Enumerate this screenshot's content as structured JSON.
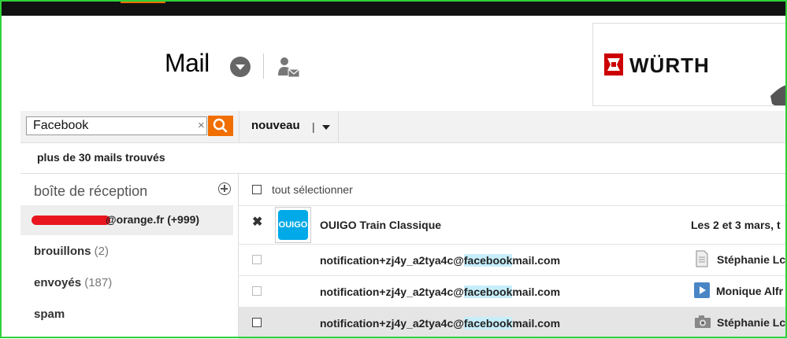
{
  "header": {
    "app_title": "Mail",
    "brand_color": "#f16e00",
    "dropdown_icon": "chevron-down-circle-icon",
    "contacts_icon": "contacts-icon"
  },
  "ad": {
    "brand": "WÜRTH",
    "brand_color": "#cc0000"
  },
  "search": {
    "value": "Facebook",
    "clear_label": "×"
  },
  "toolbar": {
    "new_label": "nouveau",
    "new_separator": "|"
  },
  "results": {
    "count_label": "plus de 30 mails trouvés"
  },
  "sidebar": {
    "header": "boîte de réception",
    "account": {
      "label": "@orange.fr (+999)"
    },
    "items": [
      {
        "label": "brouillons",
        "count": "(2)"
      },
      {
        "label": "envoyés",
        "count": "(187)"
      },
      {
        "label": "spam",
        "count": ""
      }
    ]
  },
  "mail_list": {
    "select_all_label": "tout sélectionner",
    "messages": [
      {
        "sender": "OUIGO Train Classique",
        "subject": "Les 2 et 3 mars, t",
        "avatar_text": "OUIGO"
      },
      {
        "sender_before": "notification+zj4y_a2tya4c@",
        "sender_match": "facebook",
        "sender_after": "mail.com",
        "recipient": "Stéphanie Lc",
        "attachment_icon": "document-icon"
      },
      {
        "sender_before": "notification+zj4y_a2tya4c@",
        "sender_match": "facebook",
        "sender_after": "mail.com",
        "recipient": "Monique Alfr",
        "attachment_icon": "video-play-icon"
      },
      {
        "sender_before": "notification+zj4y_a2tya4c@",
        "sender_match": "facebook",
        "sender_after": "mail.com",
        "recipient": "Stéphanie Lc",
        "attachment_icon": "camera-icon"
      }
    ]
  }
}
